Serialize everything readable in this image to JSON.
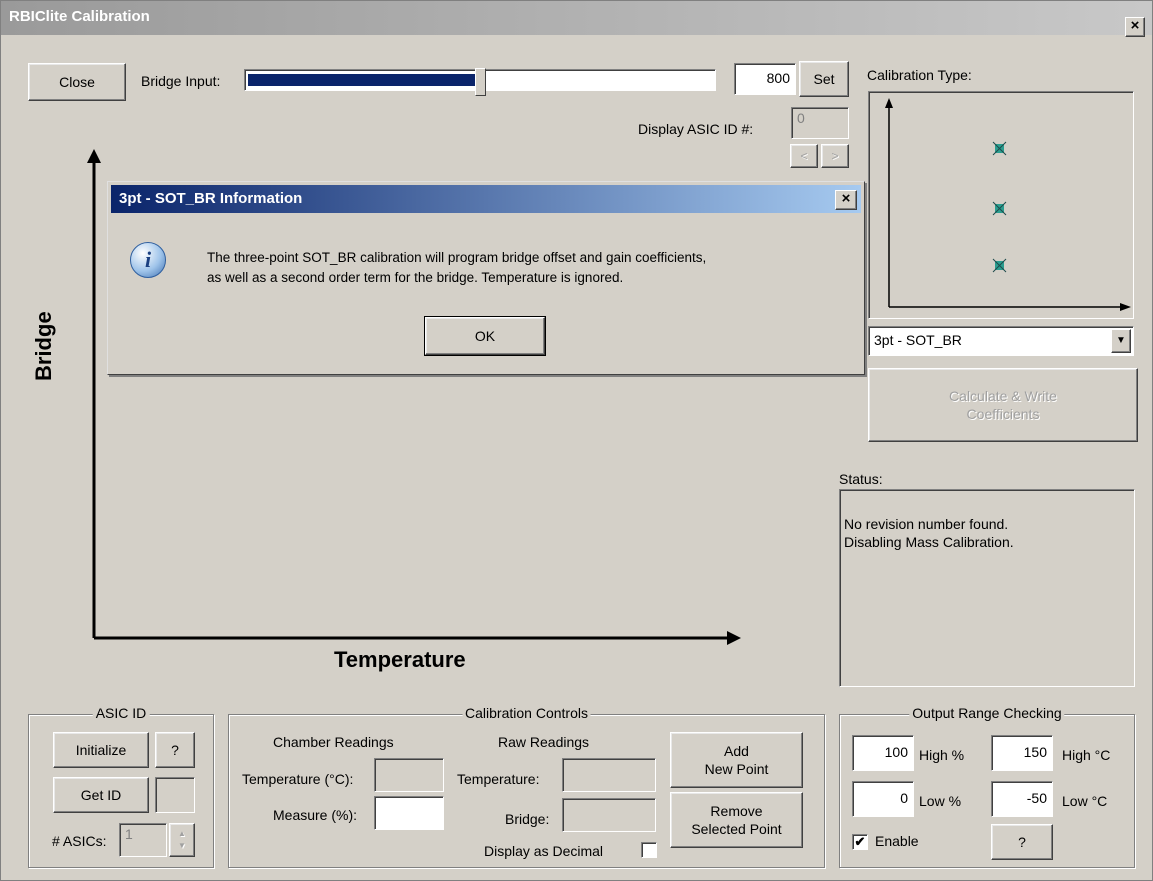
{
  "window": {
    "title": "RBIClite Calibration",
    "close_glyph": "×"
  },
  "toolbar": {
    "close_label": "Close",
    "bridge_input_label": "Bridge Input:",
    "bridge_input_value": "800",
    "slider_fraction": 0.5,
    "set_label": "Set"
  },
  "asic_display": {
    "label": "Display ASIC ID #:",
    "value": "0",
    "prev_glyph": "<",
    "next_glyph": ">"
  },
  "plot": {
    "ylabel": "Bridge",
    "xlabel": "Temperature"
  },
  "dialog": {
    "title": "3pt - SOT_BR Information",
    "close_glyph": "×",
    "icon": "info-icon",
    "icon_glyph": "i",
    "message_line1": "The three-point SOT_BR calibration will program bridge offset and gain coefficients,",
    "message_line2": "as well as a second order term for the bridge. Temperature is ignored.",
    "ok_label": "OK"
  },
  "calibration_type": {
    "label": "Calibration Type:",
    "selected": "3pt - SOT_BR",
    "dropdown_glyph": "▼",
    "calc_label_line1": "Calculate & Write",
    "calc_label_line2": "Coefficients"
  },
  "status": {
    "label": "Status:",
    "line1": "No revision number found.",
    "line2": "Disabling Mass Calibration."
  },
  "asic_id_group": {
    "title": "ASIC ID",
    "initialize_label": "Initialize",
    "help_label": "?",
    "get_id_label": "Get ID",
    "num_asics_label": "# ASICs:",
    "num_asics_value": "1"
  },
  "calibration_controls": {
    "title": "Calibration Controls",
    "chamber_header": "Chamber Readings",
    "raw_header": "Raw Readings",
    "temperature_c_label": "Temperature (°C):",
    "measure_label": "Measure (%):",
    "raw_temperature_label": "Temperature:",
    "raw_bridge_label": "Bridge:",
    "display_decimal_label": "Display as Decimal",
    "add_point_line1": "Add",
    "add_point_line2": "New Point",
    "remove_point_line1": "Remove",
    "remove_point_line2": "Selected Point"
  },
  "output_range": {
    "title": "Output Range Checking",
    "high_pct_value": "100",
    "high_pct_label": "High %",
    "high_c_value": "150",
    "high_c_label": "High °C",
    "low_pct_value": "0",
    "low_pct_label": "Low %",
    "low_c_value": "-50",
    "low_c_label": "Low °C",
    "enable_label": "Enable",
    "enable_checked": true,
    "check_glyph": "✔",
    "help_label": "?"
  },
  "colors": {
    "window_bg": "#d4d0c8",
    "dialog_title": "#0a246a",
    "slider_fill": "#0a246a",
    "marker": "#2a9d8f"
  }
}
